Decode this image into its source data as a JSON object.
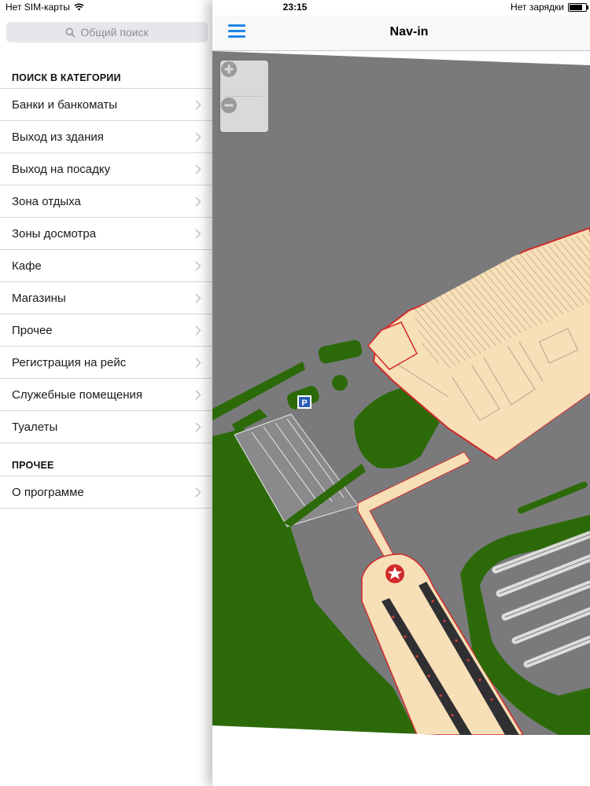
{
  "status": {
    "carrier": "Нет SIM-карты",
    "time": "23:15",
    "battery_text": "Нет зарядки"
  },
  "search": {
    "placeholder": "Общий поиск"
  },
  "categories": {
    "title": "ПОИСК В КАТЕГОРИИ",
    "items": [
      "Банки и банкоматы",
      "Выход из здания",
      "Выход на посадку",
      "Зона отдыха",
      "Зоны досмотра",
      "Кафе",
      "Магазины",
      "Прочее",
      "Регистрация на рейс",
      "Служебные помещения",
      "Туалеты"
    ]
  },
  "other": {
    "title": "ПРОЧЕЕ",
    "items": [
      "О программе"
    ]
  },
  "navbar": {
    "title": "Nav-in"
  },
  "map": {
    "parking_label": "P",
    "zoom_in_icon": "plus-circle-icon",
    "zoom_out_icon": "minus-circle-icon"
  },
  "colors": {
    "accent": "#1f86e6",
    "map_gray": "#7a7a7c",
    "grass": "#2c6a09",
    "building": "#f7dfb7",
    "building_edge": "#d02a2a"
  }
}
